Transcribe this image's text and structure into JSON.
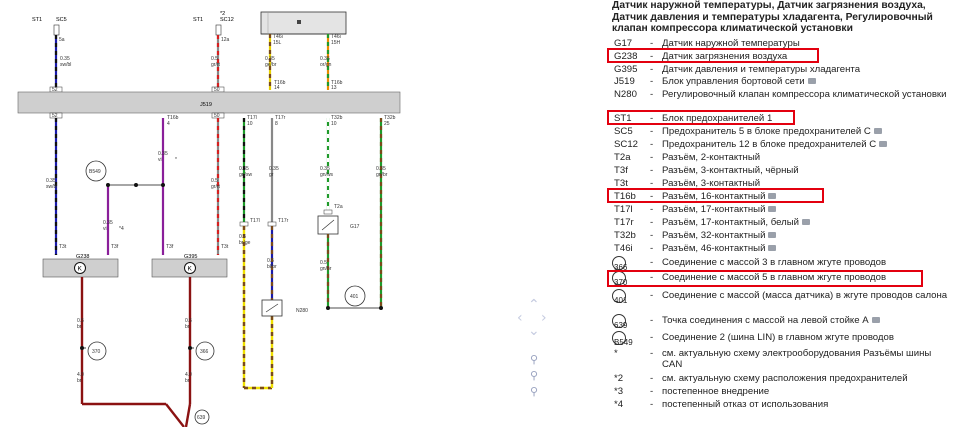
{
  "legend": {
    "title": "Датчик наружной температуры, Датчик загрязнения воздуха, Датчик давления и температуры хладагента, Регулировочный клапан компрессора климатической установки",
    "items": [
      {
        "code": "G17",
        "text": "Датчик наружной температуры"
      },
      {
        "code": "G238",
        "text": "Датчик загрязнения воздуха"
      },
      {
        "code": "G395",
        "text": "Датчик давления и температуры хладагента"
      },
      {
        "code": "J519",
        "text": "Блок управления бортовой сети"
      },
      {
        "code": "N280",
        "text": "Регулировочный клапан компрессора климатической установки"
      },
      {
        "code": "ST1",
        "text": "Блок предохранителей 1"
      },
      {
        "code": "SC5",
        "text": "Предохранитель 5 в блоке предохранителей C"
      },
      {
        "code": "SC12",
        "text": "Предохранитель 12 в блоке предохранителей C"
      },
      {
        "code": "T2a",
        "text": "Разъём, 2-контактный"
      },
      {
        "code": "T3f",
        "text": "Разъём, 3-контактный, чёрный"
      },
      {
        "code": "T3t",
        "text": "Разъём, 3-контактный"
      },
      {
        "code": "T16b",
        "text": "Разъём, 16-контактный"
      },
      {
        "code": "T17l",
        "text": "Разъём, 17-контактный"
      },
      {
        "code": "T17r",
        "text": "Разъём, 17-контактный, белый"
      },
      {
        "code": "T32b",
        "text": "Разъём, 32-контактный"
      },
      {
        "code": "T46i",
        "text": "Разъём, 46-контактный"
      },
      {
        "code": "366",
        "text": "Соединение с массой 3 в главном жгуте проводов"
      },
      {
        "code": "370",
        "text": "Соединение с массой 5 в главном жгуте проводов"
      },
      {
        "code": "401",
        "text": "Соединение с массой (масса датчика) в жгуте проводов салона"
      },
      {
        "code": "639",
        "text": "Точка соединения с массой на левой стойке A"
      },
      {
        "code": "B549",
        "text": "Соединение 2 (шина LIN) в главном жгуте проводов"
      },
      {
        "code": "*",
        "text": "см. актуальную схему электрооборудования Разъёмы шины CAN"
      },
      {
        "code": "*2",
        "text": "см. актуальную схему расположения предохранителей"
      },
      {
        "code": "*3",
        "text": "постепенное внедрение"
      },
      {
        "code": "*4",
        "text": "постепенный отказ от использования"
      }
    ],
    "dash": "-"
  },
  "diagram": {
    "bus_label": "J519",
    "top": {
      "st1_a": "ST1",
      "sc5": "SC5",
      "st1_b": "ST1",
      "sc12": "SC12",
      "star2": "*2",
      "t2a": "T2a",
      "t46i_1": "T46i",
      "t46i_2": "T46i",
      "pin15l": "15L",
      "pin15h": "15H",
      "pin5a": "5a",
      "pin12a": "12a",
      "pin52": "52",
      "pin50": "50",
      "t16b_1": "T16b",
      "t16b_2": "T16b",
      "pin14": "14",
      "pin13": "13"
    },
    "wires": {
      "w1": {
        "cs": "0.35",
        "color": "sw/bl"
      },
      "w2": {
        "cs": "0.5",
        "color": "gr/rt"
      },
      "w3": {
        "cs": "0.35",
        "color": "ge/br"
      },
      "w4": {
        "cs": "0.35",
        "color": "or/gn"
      },
      "w5": {
        "cs": "0.35",
        "color": "sw/bl"
      },
      "w6": {
        "cs": "0.35",
        "color": "vi"
      },
      "w7": {
        "cs": "0.35",
        "color": "vi"
      },
      "w8": {
        "cs": "0.5",
        "color": "gr/rt"
      },
      "w9": {
        "cs": "0.35",
        "color": "gn/sw"
      },
      "w10": {
        "cs": "0.35",
        "color": "gr"
      },
      "w11": {
        "cs": "0.35",
        "color": "gn/ws"
      },
      "w12": {
        "cs": "0.35",
        "color": "gn/br"
      },
      "w13": {
        "cs": "0.5",
        "color": "br/ge"
      },
      "w14": {
        "cs": "0.5",
        "color": "bl/br"
      },
      "w15": {
        "cs": "0.5",
        "color": "gn/br"
      },
      "w16": {
        "cs": "0.5",
        "color": "br"
      },
      "w17": {
        "cs": "0.5",
        "color": "br"
      },
      "w18": {
        "cs": "4.0",
        "color": "br"
      },
      "w19": {
        "cs": "4.0",
        "color": "br"
      }
    },
    "pins": {
      "p52": "52",
      "p50": "50",
      "t16b4": "T16b",
      "pin4": "4",
      "t17l": "T17l",
      "t17l_pin": "10",
      "t17r": "T17r",
      "t17r_pin": "8",
      "t32b": "T32b",
      "t32b_pin": "10",
      "t32b_2": "T32b",
      "t32b_2_pin": "25",
      "t3f_a": "T3f",
      "t3f_b": "T3f",
      "t3t_a": "T3t",
      "t3t_b": "T3t",
      "t2a": "T2a",
      "t17l_b": "T17l",
      "t17r_b": "T17r",
      "star4": "*4",
      "star": "*"
    },
    "components": {
      "g238": "G238",
      "g395": "G395",
      "n280": "N280",
      "g17": "G17",
      "g1": "B549",
      "g2": "370",
      "g3": "366",
      "g4": "401",
      "g5": "639"
    }
  },
  "colors": {
    "highlight": "#e3000f",
    "bus": "#cfcfcf",
    "nav": "#c5cbe0"
  },
  "icons": [
    "chevron-up-icon",
    "chevron-left-icon",
    "chevron-right-icon",
    "chevron-down-icon",
    "zoom-in-icon",
    "zoom-fit-icon",
    "zoom-out-icon",
    "camera-icon"
  ]
}
